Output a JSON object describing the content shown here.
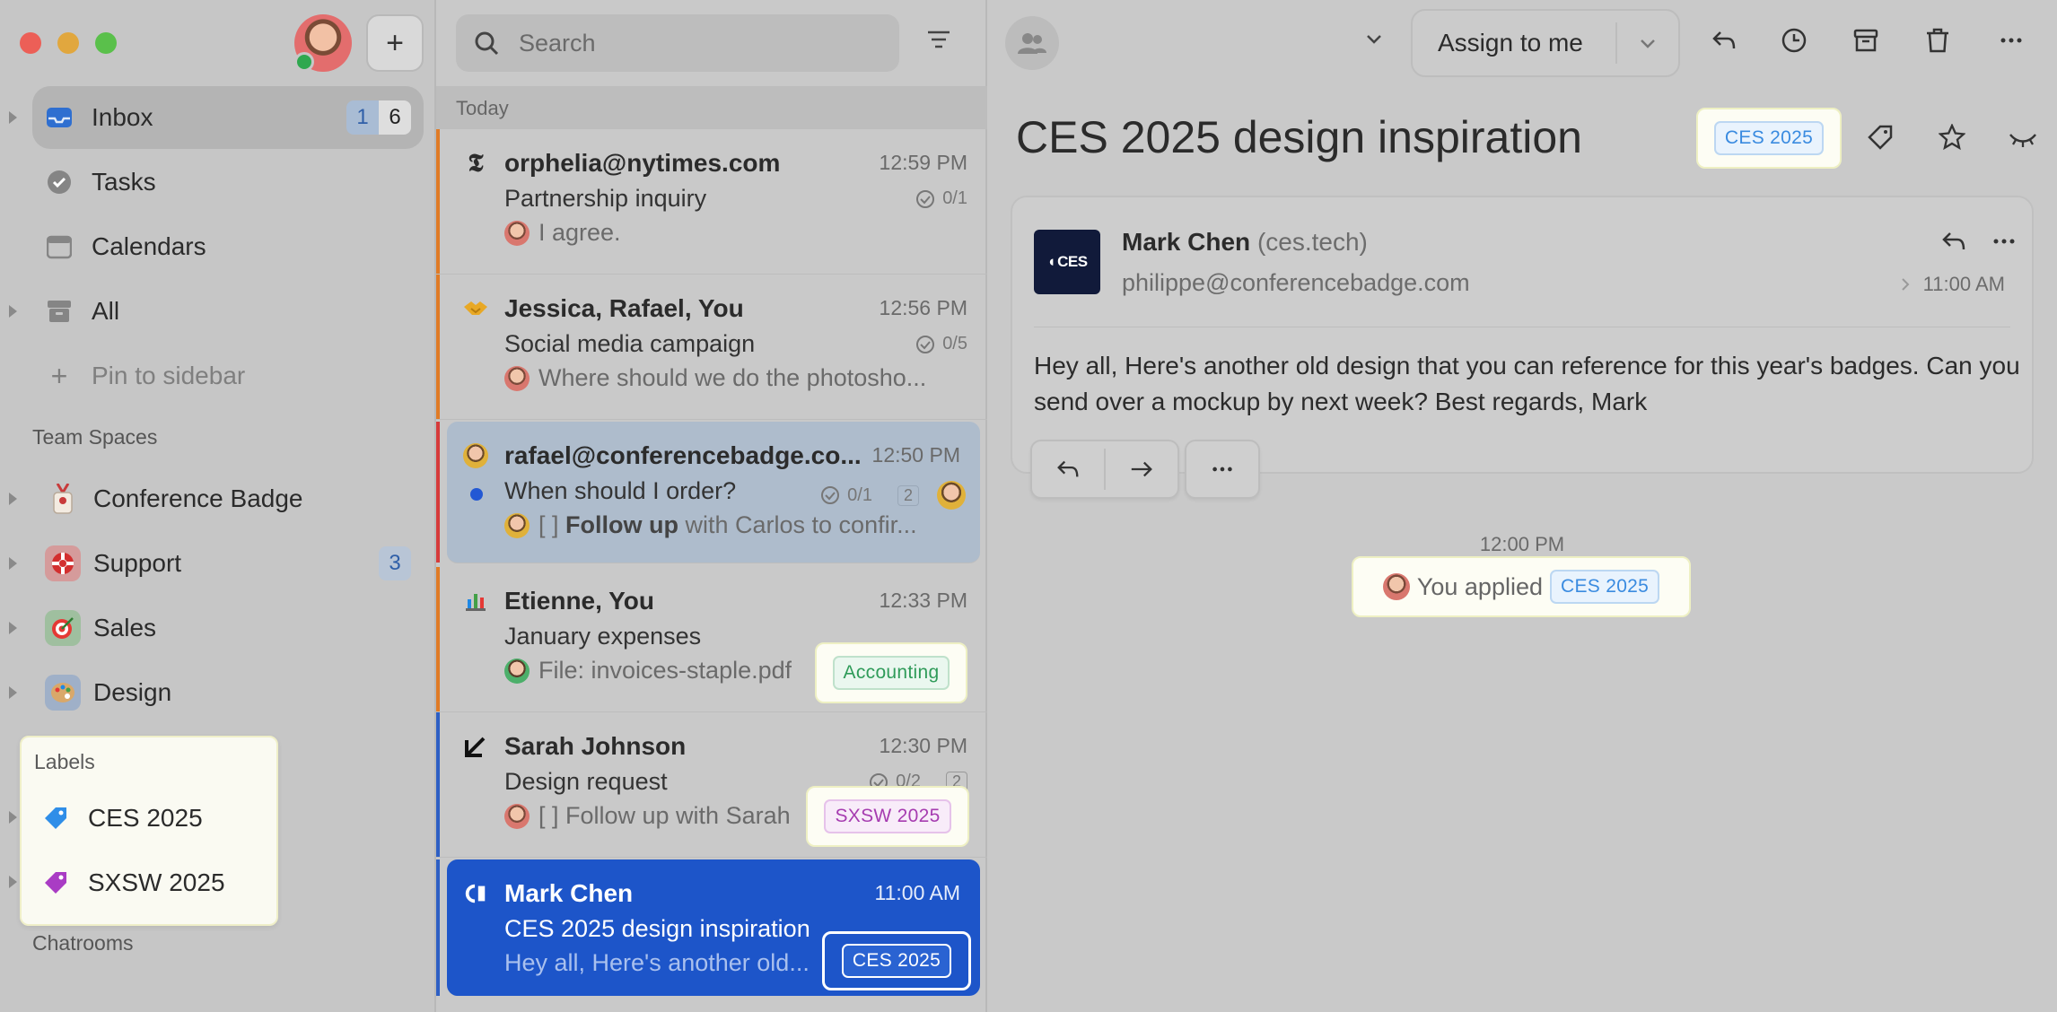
{
  "sidebar": {
    "compose_label": "+",
    "inbox": {
      "label": "Inbox",
      "count_unread": "1",
      "count_total": "6"
    },
    "tasks": "Tasks",
    "calendars": "Calendars",
    "all": "All",
    "pin": "Pin to sidebar",
    "team_spaces_heading": "Team Spaces",
    "spaces": [
      {
        "label": "Conference Badge",
        "icon": "badge-icon"
      },
      {
        "label": "Support",
        "icon": "lifebuoy-icon",
        "count": "3"
      },
      {
        "label": "Sales",
        "icon": "target-icon"
      },
      {
        "label": "Design",
        "icon": "palette-icon"
      }
    ],
    "labels_heading": "Labels",
    "labels": [
      {
        "label": "CES 2025",
        "color": "#2f8ee8"
      },
      {
        "label": "SXSW 2025",
        "color": "#a93cc4"
      }
    ],
    "chatrooms_heading": "Chatrooms"
  },
  "list": {
    "search_placeholder": "Search",
    "day_heading": "Today",
    "messages": [
      {
        "from": "orphelia@nytimes.com",
        "time": "12:59 PM",
        "subject": "Partnership inquiry",
        "meta": "0/1",
        "preview": "I agree.",
        "bar": "#e07b26",
        "icon": "nyt-icon"
      },
      {
        "from": "Jessica, Rafael, You",
        "time": "12:56 PM",
        "subject": "Social media campaign",
        "meta": "0/5",
        "preview": "Where should we do the photosho...",
        "bar": "#e07b26",
        "icon": "handshake-icon"
      },
      {
        "from": "rafael@conferencebadge.co...",
        "time": "12:50 PM",
        "subject": "When should I order?",
        "meta": "0/1",
        "meta2": "2",
        "preview_prefix": "[ ] ",
        "preview_bold": "Follow up",
        "preview_rest": " with Carlos to confir...",
        "bar": "#d63b3b",
        "icon": "avatar-icon"
      },
      {
        "from": "Etienne, You",
        "time": "12:33 PM",
        "subject": "January expenses",
        "preview": "File: invoices-staple.pdf",
        "tag": "Accounting",
        "bar": "#e07b26",
        "icon": "chart-icon"
      },
      {
        "from": "Sarah Johnson",
        "time": "12:30 PM",
        "subject": "Design request",
        "meta": "0/2",
        "meta2": "2",
        "preview": "[ ] Follow up with Sarah",
        "tag": "SXSW 2025",
        "bar": "#2d5fc4",
        "icon": "arrow-down-left-icon"
      },
      {
        "from": "Mark Chen",
        "time": "11:00 AM",
        "subject": "CES 2025 design inspiration",
        "preview": "Hey all, Here's another old...",
        "tag": "CES 2025",
        "bar": "#2d5fc4",
        "icon": "ces-icon"
      }
    ]
  },
  "detail": {
    "assign_label": "Assign to me",
    "subject": "CES 2025 design inspiration",
    "subject_tag": "CES 2025",
    "sender_name": "Mark Chen",
    "sender_domain": "(ces.tech)",
    "sender_email": "philippe@conferencebadge.com",
    "time": "11:00 AM",
    "logo_text": "CES",
    "body": "Hey all, Here's another old design that you can reference for this year's badges. Can you send over a mockup by next week? Best regards, Mark",
    "event_time": "12:00 PM",
    "event_text": "You applied",
    "event_tag": "CES 2025"
  }
}
